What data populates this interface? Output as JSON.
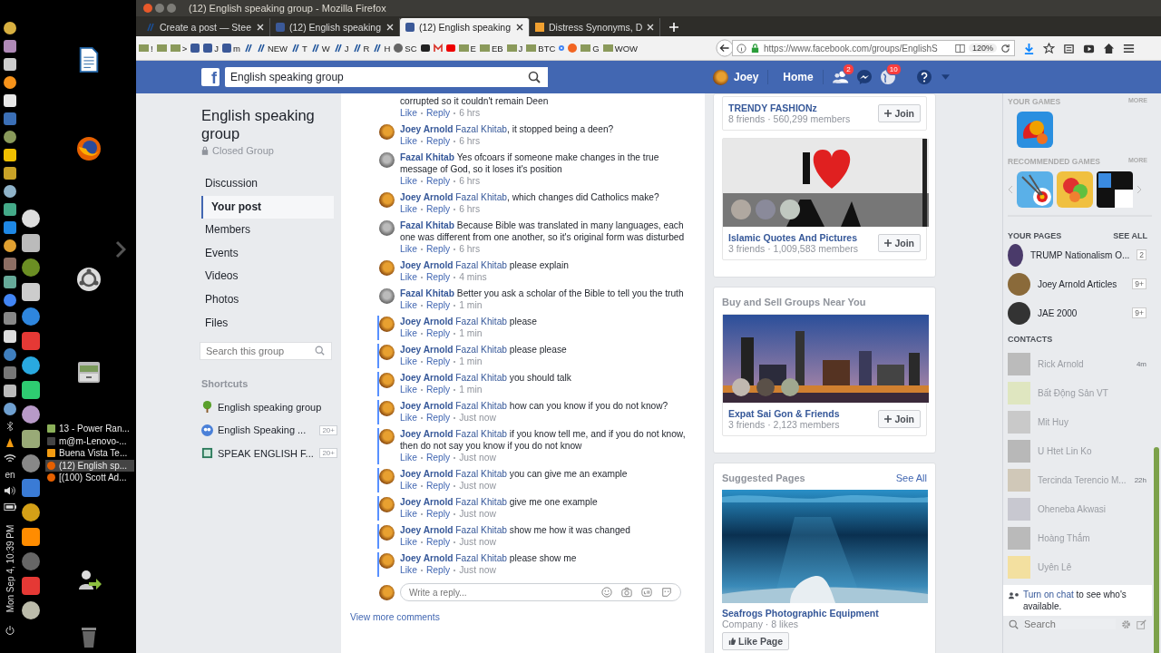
{
  "desktop": {
    "keyboard_layout": "en",
    "clock": "Mon Sep 4, 10:39 PM",
    "windows": [
      {
        "title": "13 - Power Ran...",
        "kind": "folder",
        "selected": false
      },
      {
        "title": "m@m-Lenovo-...",
        "kind": "terminal",
        "selected": false
      },
      {
        "title": "Buena Vista Te...",
        "kind": "cone",
        "selected": false
      },
      {
        "title": "(12) English sp...",
        "kind": "browser",
        "selected": true
      },
      {
        "title": "[(100) Scott Ad...",
        "kind": "browser",
        "selected": false
      }
    ]
  },
  "window": {
    "title": "(12) English speaking group - Mozilla Firefox"
  },
  "tabs": [
    {
      "label": "Create a post — Stee",
      "kind": "steem",
      "selected": false
    },
    {
      "label": "(12) English speaking",
      "kind": "fb",
      "selected": false
    },
    {
      "label": "(12) English speaking",
      "kind": "fb",
      "selected": true
    },
    {
      "label": "Distress Synonyms, D",
      "kind": "book",
      "selected": false
    }
  ],
  "bookmarks": [
    {
      "kind": "folder",
      "label": "!"
    },
    {
      "kind": "folder"
    },
    {
      "kind": "folder",
      "label": ">"
    },
    {
      "kind": "fb"
    },
    {
      "kind": "fb",
      "label": "J"
    },
    {
      "kind": "fb",
      "label": "m"
    },
    {
      "kind": "steem"
    },
    {
      "kind": "steem",
      "label": "NEW"
    },
    {
      "kind": "steem",
      "label": "T"
    },
    {
      "kind": "steem",
      "label": "W"
    },
    {
      "kind": "steem",
      "label": "J"
    },
    {
      "kind": "steem",
      "label": "R"
    },
    {
      "kind": "steem",
      "label": "H"
    },
    {
      "kind": "globe",
      "label": "SC"
    },
    {
      "kind": "bus"
    },
    {
      "kind": "mail"
    },
    {
      "kind": "video"
    },
    {
      "kind": "folder",
      "label": "E"
    },
    {
      "kind": "folder",
      "label": "EB"
    },
    {
      "kind": "folder",
      "label": "J"
    },
    {
      "kind": "folder",
      "label": "BTC"
    },
    {
      "kind": "g"
    },
    {
      "kind": "circle"
    },
    {
      "kind": "folder",
      "label": "G"
    },
    {
      "kind": "folder",
      "label": "WOW"
    }
  ],
  "address_bar": {
    "url": "https://www.facebook.com/groups/EnglishS",
    "zoom": "120%"
  },
  "facebook_bar": {
    "logo": "f",
    "search_value": "English speaking group",
    "user": "Joey",
    "home": "Home",
    "friend_requests": "2",
    "notifications": "10"
  },
  "group_nav": {
    "title": "English speaking group",
    "privacy": "Closed Group",
    "items": [
      {
        "label": "Discussion",
        "selected": false
      },
      {
        "label": "Your post",
        "selected": true
      },
      {
        "label": "Members",
        "selected": false
      },
      {
        "label": "Events",
        "selected": false
      },
      {
        "label": "Videos",
        "selected": false
      },
      {
        "label": "Photos",
        "selected": false
      },
      {
        "label": "Files",
        "selected": false
      }
    ],
    "search_placeholder": "Search this group",
    "shortcuts_title": "Shortcuts",
    "shortcuts": [
      {
        "label": "English speaking group",
        "kind": "tree"
      },
      {
        "label": "English Speaking ...",
        "kind": "people",
        "count": "20+"
      },
      {
        "label": "SPEAK ENGLISH F...",
        "kind": "book",
        "count": "20+"
      }
    ]
  },
  "comments": [
    {
      "kind": "continuation",
      "text": "corrupted so it couldn't remain Deen",
      "like": "Like",
      "reply": "Reply",
      "time": "6 hrs",
      "highlighted": false
    },
    {
      "kind": "joey",
      "author": "Joey Arnold",
      "mention": "Fazal Khitab",
      "text": ", it stopped being a deen?",
      "like": "Like",
      "reply": "Reply",
      "time": "6 hrs",
      "highlighted": false
    },
    {
      "kind": "fazal",
      "author": "Fazal Khitab",
      "text": " Yes ofcoars if someone make changes in the true message of God, so it loses it's position",
      "like": "Like",
      "reply": "Reply",
      "time": "6 hrs",
      "highlighted": false
    },
    {
      "kind": "joey",
      "author": "Joey Arnold",
      "mention": "Fazal Khitab",
      "text": ", which changes did Catholics make?",
      "like": "Like",
      "reply": "Reply",
      "time": "6 hrs",
      "highlighted": false
    },
    {
      "kind": "fazal",
      "author": "Fazal Khitab",
      "text": " Because Bible was translated in many languages, each one was different from one another, so it's original form was disturbed",
      "like": "Like",
      "reply": "Reply",
      "time": "6 hrs",
      "highlighted": false
    },
    {
      "kind": "joey",
      "author": "Joey Arnold",
      "mention": "Fazal Khitab",
      "text": " please explain",
      "like": "Like",
      "reply": "Reply",
      "time": "4 mins",
      "highlighted": false
    },
    {
      "kind": "fazal",
      "author": "Fazal Khitab",
      "text": " Better you ask a scholar of the Bible to tell you the truth",
      "like": "Like",
      "reply": "Reply",
      "time": "1 min",
      "highlighted": false
    },
    {
      "kind": "joey",
      "author": "Joey Arnold",
      "mention": "Fazal Khitab",
      "text": " please",
      "like": "Like",
      "reply": "Reply",
      "time": "1 min",
      "highlighted": true
    },
    {
      "kind": "joey",
      "author": "Joey Arnold",
      "mention": "Fazal Khitab",
      "text": " please please",
      "like": "Like",
      "reply": "Reply",
      "time": "1 min",
      "highlighted": true
    },
    {
      "kind": "joey",
      "author": "Joey Arnold",
      "mention": "Fazal Khitab",
      "text": " you should talk",
      "like": "Like",
      "reply": "Reply",
      "time": "1 min",
      "highlighted": true
    },
    {
      "kind": "joey",
      "author": "Joey Arnold",
      "mention": "Fazal Khitab",
      "text": " how can you know if you do not know?",
      "like": "Like",
      "reply": "Reply",
      "time": "Just now",
      "highlighted": true
    },
    {
      "kind": "joey",
      "author": "Joey Arnold",
      "mention": "Fazal Khitab",
      "text": " if you know tell me, and if you do not know, then do not say you know if you do not know",
      "like": "Like",
      "reply": "Reply",
      "time": "Just now",
      "highlighted": true
    },
    {
      "kind": "joey",
      "author": "Joey Arnold",
      "mention": "Fazal Khitab",
      "text": " you can give me an example",
      "like": "Like",
      "reply": "Reply",
      "time": "Just now",
      "highlighted": true
    },
    {
      "kind": "joey",
      "author": "Joey Arnold",
      "mention": "Fazal Khitab",
      "text": " give me one example",
      "like": "Like",
      "reply": "Reply",
      "time": "Just now",
      "highlighted": true
    },
    {
      "kind": "joey",
      "author": "Joey Arnold",
      "mention": "Fazal Khitab",
      "text": " show me how it was changed",
      "like": "Like",
      "reply": "Reply",
      "time": "Just now",
      "highlighted": true
    },
    {
      "kind": "joey",
      "author": "Joey Arnold",
      "mention": "Fazal Khitab",
      "text": " please show me",
      "like": "Like",
      "reply": "Reply",
      "time": "Just now",
      "highlighted": true
    }
  ],
  "reply_box": {
    "placeholder": "Write a reply..."
  },
  "view_more": "View more comments",
  "suggested_groups": [
    {
      "name": "TRENDY FASHIONz",
      "meta": "8 friends · 560,299 members",
      "join": "Join"
    },
    {
      "kind": "picture",
      "name": "Islamic Quotes And Pictures",
      "meta": "3 friends · 1,009,583 members",
      "join": "Join"
    }
  ],
  "buy_sell": {
    "title": "Buy and Sell Groups Near You",
    "groups": [
      {
        "kind": "picture",
        "name": "Expat Sai Gon & Friends",
        "meta": "3 friends · 2,123 members",
        "join": "Join"
      }
    ]
  },
  "suggested_pages": {
    "title": "Suggested Pages",
    "see_all": "See All",
    "pages": [
      {
        "kind": "picture",
        "name": "Seafrogs Photographic Equipment",
        "meta": "Company · 8 likes",
        "like": "Like Page"
      }
    ]
  },
  "sidebar": {
    "your_games": "YOUR GAMES",
    "more": "MORE",
    "recommended": "RECOMMENDED GAMES",
    "more2": "MORE",
    "your_pages": "YOUR PAGES",
    "see_all": "SEE ALL",
    "pages": [
      {
        "name": "TRUMP Nationalism O...",
        "count": "2"
      },
      {
        "name": "Joey Arnold Articles",
        "count": "9+"
      },
      {
        "name": "JAE 2000",
        "count": "9+"
      }
    ],
    "contacts_title": "CONTACTS",
    "contacts": [
      {
        "name": "Rick Arnold",
        "time": "4m"
      },
      {
        "name": "Bất Động Sản VT"
      },
      {
        "name": "Mit Huy"
      },
      {
        "name": "U Htet Lin Ko"
      },
      {
        "name": "Tercinda Terencio M...",
        "time": "22h"
      },
      {
        "name": "Oheneba Akwasi"
      },
      {
        "name": "Hoàng Thắm"
      },
      {
        "name": "Uyên Lê"
      }
    ],
    "chat_link": "Turn on chat",
    "chat_text": " to see who's available.",
    "search_placeholder": "Search"
  }
}
